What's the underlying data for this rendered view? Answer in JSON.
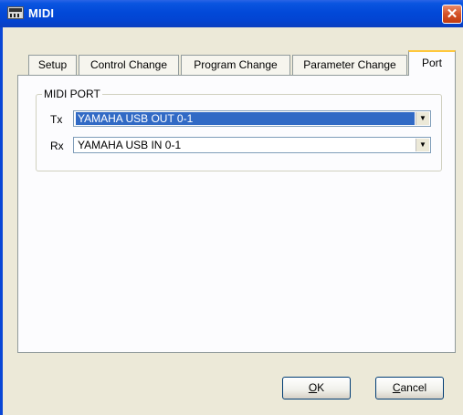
{
  "window": {
    "title": "MIDI",
    "close_label": "✕"
  },
  "tabs": [
    {
      "label": "Setup"
    },
    {
      "label": "Control Change"
    },
    {
      "label": "Program Change"
    },
    {
      "label": "Parameter Change"
    },
    {
      "label": "Port",
      "active": true
    }
  ],
  "midi_port": {
    "group_label": "MIDI PORT",
    "tx": {
      "label": "Tx",
      "value": "YAMAHA USB OUT 0-1"
    },
    "rx": {
      "label": "Rx",
      "value": "YAMAHA USB IN 0-1"
    }
  },
  "buttons": {
    "ok": {
      "mnemonic": "O",
      "rest": "K"
    },
    "cancel": {
      "mnemonic": "C",
      "rest": "ancel"
    }
  },
  "colors": {
    "title_bar": "#0a55e0",
    "selection": "#316ac5",
    "active_tab_accent": "#ffc83c",
    "close_button": "#d45227"
  }
}
